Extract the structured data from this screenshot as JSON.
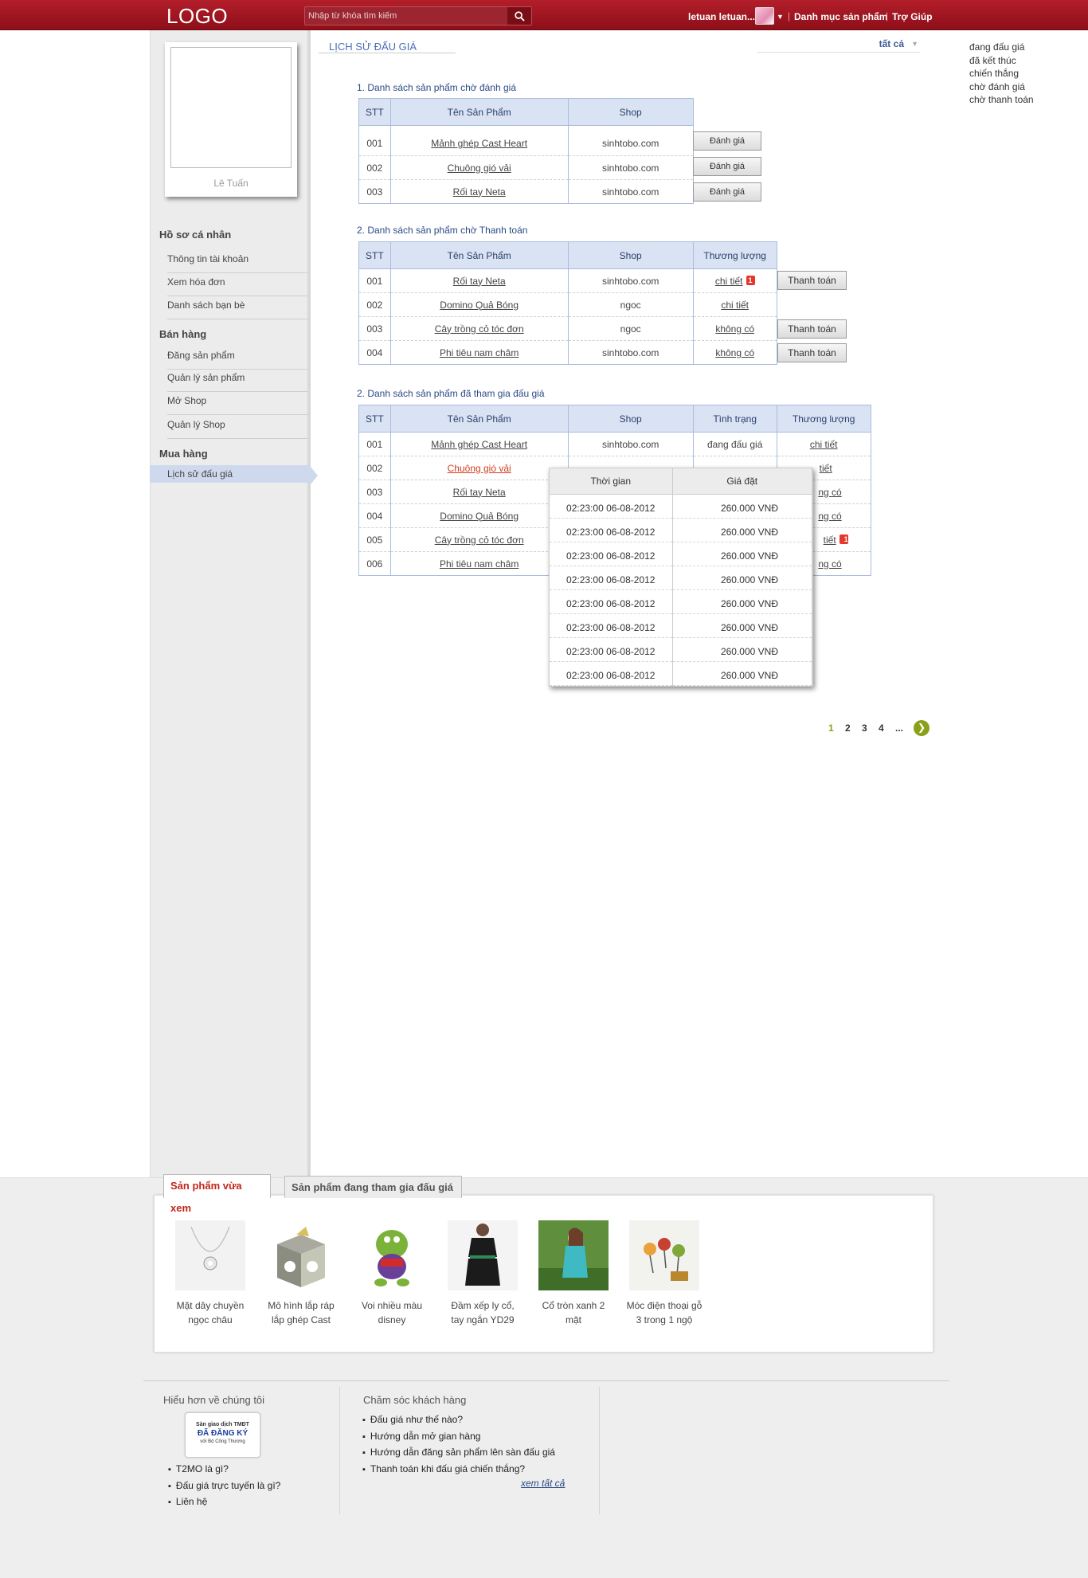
{
  "header": {
    "logo": "LOGO",
    "search_placeholder": "Nhập từ khóa tìm kiếm",
    "user_name": "letuan letuan...",
    "links": [
      "Danh mục sản phẩm",
      "Trợ Giúp"
    ]
  },
  "profile": {
    "name": "Lê Tuấn"
  },
  "sidebar": {
    "groups": [
      {
        "title": "Hồ sơ cá nhân",
        "items": [
          "Thông tin tài khoản",
          "Xem hóa đơn",
          "Danh sách bạn bè"
        ]
      },
      {
        "title": "Bán hàng",
        "items": [
          "Đăng sản phẩm",
          "Quản lý sản phẩm",
          "Mở Shop",
          "Quản lý Shop"
        ]
      },
      {
        "title": "Mua hàng",
        "items": [
          "Lịch sử đấu giá"
        ]
      }
    ]
  },
  "page": {
    "title": "LỊCH SỬ ĐẤU GIÁ",
    "filter_value": "tất cả",
    "filter_options": [
      "đang đấu giá",
      "đã kết thúc",
      "chiến thắng",
      "chờ đánh giá",
      "chờ thanh toán"
    ]
  },
  "section1": {
    "title": "1. Danh sách sản phẩm chờ đánh giá",
    "headers": [
      "STT",
      "Tên Sản Phẩm",
      "Shop"
    ],
    "button_label": "Đánh giá",
    "rows": [
      {
        "stt": "001",
        "name": "Mảnh ghép Cast Heart",
        "shop": "sinhtobo.com"
      },
      {
        "stt": "002",
        "name": "Chuông gió vải",
        "shop": "sinhtobo.com"
      },
      {
        "stt": "003",
        "name": "Rối tay Neta",
        "shop": "sinhtobo.com"
      }
    ]
  },
  "section2": {
    "title": "2. Danh sách sản phẩm chờ Thanh toán",
    "headers": [
      "STT",
      "Tên Sản Phẩm",
      "Shop",
      "Thương lượng"
    ],
    "button_label": "Thanh toán",
    "rows": [
      {
        "stt": "001",
        "name": "Rối tay Neta",
        "shop": "sinhtobo.com",
        "nego": "chi tiết",
        "badge": "1"
      },
      {
        "stt": "002",
        "name": "Domino Quả Bóng",
        "shop": "ngoc",
        "nego": "chi tiết",
        "badge": ""
      },
      {
        "stt": "003",
        "name": "Cây trồng cỏ tóc đơn",
        "shop": "ngoc",
        "nego": "không có",
        "badge": ""
      },
      {
        "stt": "004",
        "name": "Phi tiêu nam châm",
        "shop": "sinhtobo.com",
        "nego": "không có",
        "badge": ""
      }
    ]
  },
  "section3": {
    "title": "2. Danh sách sản phẩm đã tham gia đấu giá",
    "headers": [
      "STT",
      "Tên Sản Phẩm",
      "Shop",
      "Tình trạng",
      "Thương lượng"
    ],
    "rows": [
      {
        "stt": "001",
        "name": "Mảnh ghép Cast Heart",
        "shop": "sinhtobo.com",
        "status": "đang đấu giá",
        "nego": "chi tiết"
      },
      {
        "stt": "002",
        "name": "Chuông gió vải",
        "shop": "",
        "status": "",
        "nego": "tiết"
      },
      {
        "stt": "003",
        "name": "Rối tay Neta",
        "shop": "",
        "status": "",
        "nego": "ng có"
      },
      {
        "stt": "004",
        "name": "Domino Quả Bóng",
        "shop": "",
        "status": "",
        "nego": "ng có"
      },
      {
        "stt": "005",
        "name": "Cây trồng cỏ tóc đơn",
        "shop": "",
        "status": "",
        "nego": "tiết",
        "badge": "1"
      },
      {
        "stt": "006",
        "name": "Phi tiêu nam châm",
        "shop": "",
        "status": "",
        "nego": "ng có"
      }
    ]
  },
  "popup": {
    "headers": [
      "Thời gian",
      "Giá đặt"
    ],
    "rows": [
      {
        "time": "02:23:00 06-08-2012",
        "price": "260.000 VNĐ"
      },
      {
        "time": "02:23:00 06-08-2012",
        "price": "260.000 VNĐ"
      },
      {
        "time": "02:23:00 06-08-2012",
        "price": "260.000 VNĐ"
      },
      {
        "time": "02:23:00 06-08-2012",
        "price": "260.000 VNĐ"
      },
      {
        "time": "02:23:00 06-08-2012",
        "price": "260.000 VNĐ"
      },
      {
        "time": "02:23:00 06-08-2012",
        "price": "260.000 VNĐ"
      },
      {
        "time": "02:23:00 06-08-2012",
        "price": "260.000 VNĐ"
      },
      {
        "time": "02:23:00 06-08-2012",
        "price": "260.000 VNĐ"
      }
    ]
  },
  "pagination": {
    "pages": [
      "1",
      "2",
      "3",
      "4",
      "..."
    ],
    "current": "1"
  },
  "bottom_tabs": {
    "active": "Sản phẩm vừa xem",
    "inactive": "Sản phẩm đang tham gia đấu giá",
    "products": [
      {
        "line1": "Mặt dây chuyền",
        "line2": "ngọc châu"
      },
      {
        "line1": "Mô hình lắp ráp",
        "line2": "lắp ghép Cast"
      },
      {
        "line1": "Voi nhiều màu",
        "line2": "disney"
      },
      {
        "line1": "Đầm xếp ly cổ,",
        "line2": "tay ngắn YD29"
      },
      {
        "line1": "Cổ tròn xanh 2",
        "line2": "mặt"
      },
      {
        "line1": "Móc điện thoại gỗ",
        "line2": "3 trong 1 ngộ"
      }
    ]
  },
  "footer": {
    "col1_title": "Hiểu hơn về chúng tôi",
    "badge": {
      "l1": "Sàn giao dịch TMĐT",
      "l2": "ĐÃ ĐĂNG KÝ",
      "l3": "với Bộ Công Thương"
    },
    "col1_links": [
      "T2MO là gì?",
      "Đấu giá trực tuyến là gì?",
      "Liên hệ"
    ],
    "col2_title": "Chăm sóc khách hàng",
    "col2_links": [
      "Đấu giá như thế nào?",
      "Hướng dẫn mở gian hàng",
      "Hướng dẫn đăng sản phẩm lên sàn đấu giá",
      "Thanh toán khi đấu giá chiến thắng?"
    ],
    "see_all": "xem tất cả"
  }
}
